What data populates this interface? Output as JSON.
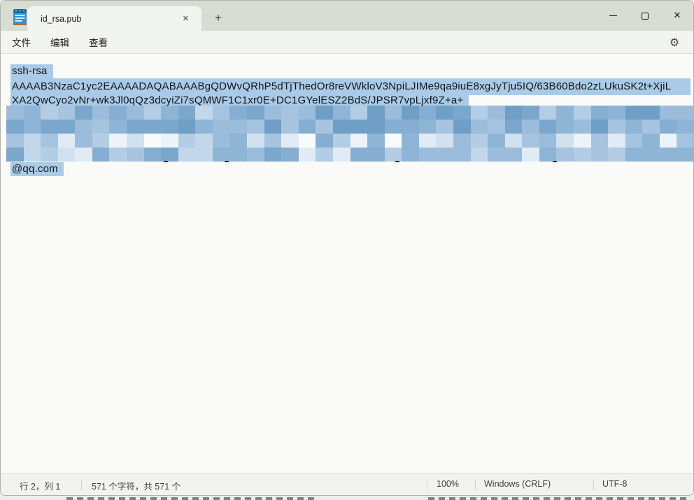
{
  "titlebar": {
    "tab": {
      "label": "id_rsa.pub",
      "close_icon": "✕"
    },
    "new_tab_icon": "+",
    "close_icon": "✕"
  },
  "menubar": {
    "items": [
      "文件",
      "编辑",
      "查看"
    ],
    "settings_icon": "⚙"
  },
  "editor": {
    "selection_color": "#a9cbe8",
    "line1": "ssh-rsa",
    "line2": "AAAAB3NzaC1yc2EAAAADAQABAAABgQDWvQRhP5dTjThedOr8reVWkloV3NpiLJIMe9qa9iuE8xgJyTju5IQ/63B60Bdo2zLUkuSK2t+XjiL",
    "line3": "XA2QwCyo2vNr+wk3Jl0qQz3dcyiZi7sQMWF1C1xr0E+DC1GYelESZ2BdS/JPSR7vpLjxf9Z+a+",
    "line_last": "@qq.com",
    "redaction": {
      "rows": 4,
      "cols": 40,
      "seed": 42,
      "palette": [
        "#6f9ec6",
        "#7ba7cc",
        "#85aed2",
        "#8fb5d6",
        "#9bbcdb",
        "#a6c4df",
        "#b3cde4",
        "#c2d7ea",
        "#d2e1f0",
        "#e1ebf5",
        "#eef3f9",
        "#f8fafc"
      ],
      "row_ranges": [
        [
          0,
          7
        ],
        [
          0,
          5
        ],
        [
          2,
          11
        ],
        [
          1,
          9
        ]
      ]
    }
  },
  "statusbar": {
    "cursor_position": "行 2，列 1",
    "character_count": "571 个字符，共 571 个",
    "zoom_level": "100%",
    "line_ending": "Windows (CRLF)",
    "encoding": "UTF-8"
  }
}
